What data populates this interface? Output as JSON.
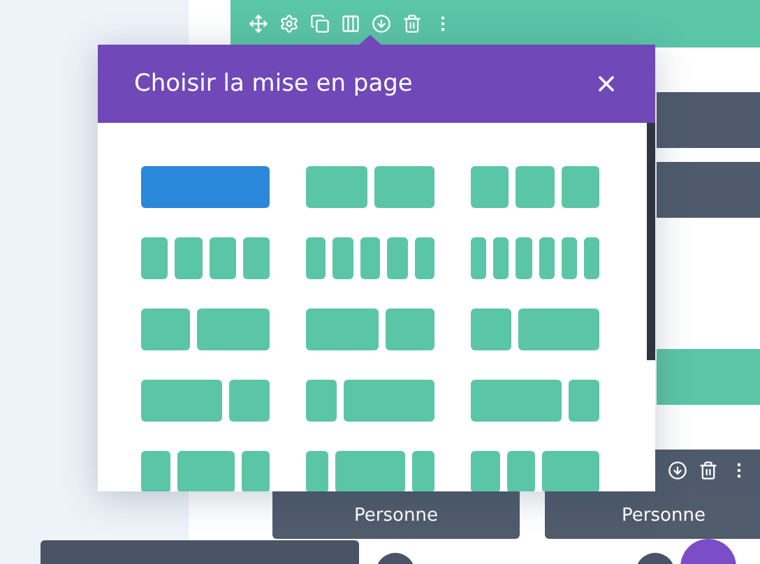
{
  "modal": {
    "title": "Choisir la mise en page",
    "layouts": [
      {
        "kind": "full",
        "selected": true
      },
      {
        "kind": "halves",
        "selected": false
      },
      {
        "kind": "thirds",
        "selected": false
      },
      {
        "kind": "quarters",
        "selected": false
      },
      {
        "kind": "fifths",
        "selected": false
      },
      {
        "kind": "sixths",
        "selected": false
      },
      {
        "kind": "narrowWide",
        "selected": false
      },
      {
        "kind": "wideNarrow",
        "selected": false
      },
      {
        "kind": "thirdTwoThirds",
        "selected": false
      },
      {
        "kind": "twoThirdsThird",
        "selected": false
      },
      {
        "kind": "quarterThreeQuarters",
        "selected": false
      },
      {
        "kind": "threeQuartersQuarter",
        "selected": false
      },
      {
        "kind": "quarterHalfQuarter",
        "selected": false
      },
      {
        "kind": "fifthThreeFifthsFifth",
        "selected": false
      },
      {
        "kind": "quarterQuarterHalf",
        "selected": false
      }
    ]
  },
  "buttons": [
    {
      "label": "Personne"
    },
    {
      "label": "Personne"
    }
  ]
}
